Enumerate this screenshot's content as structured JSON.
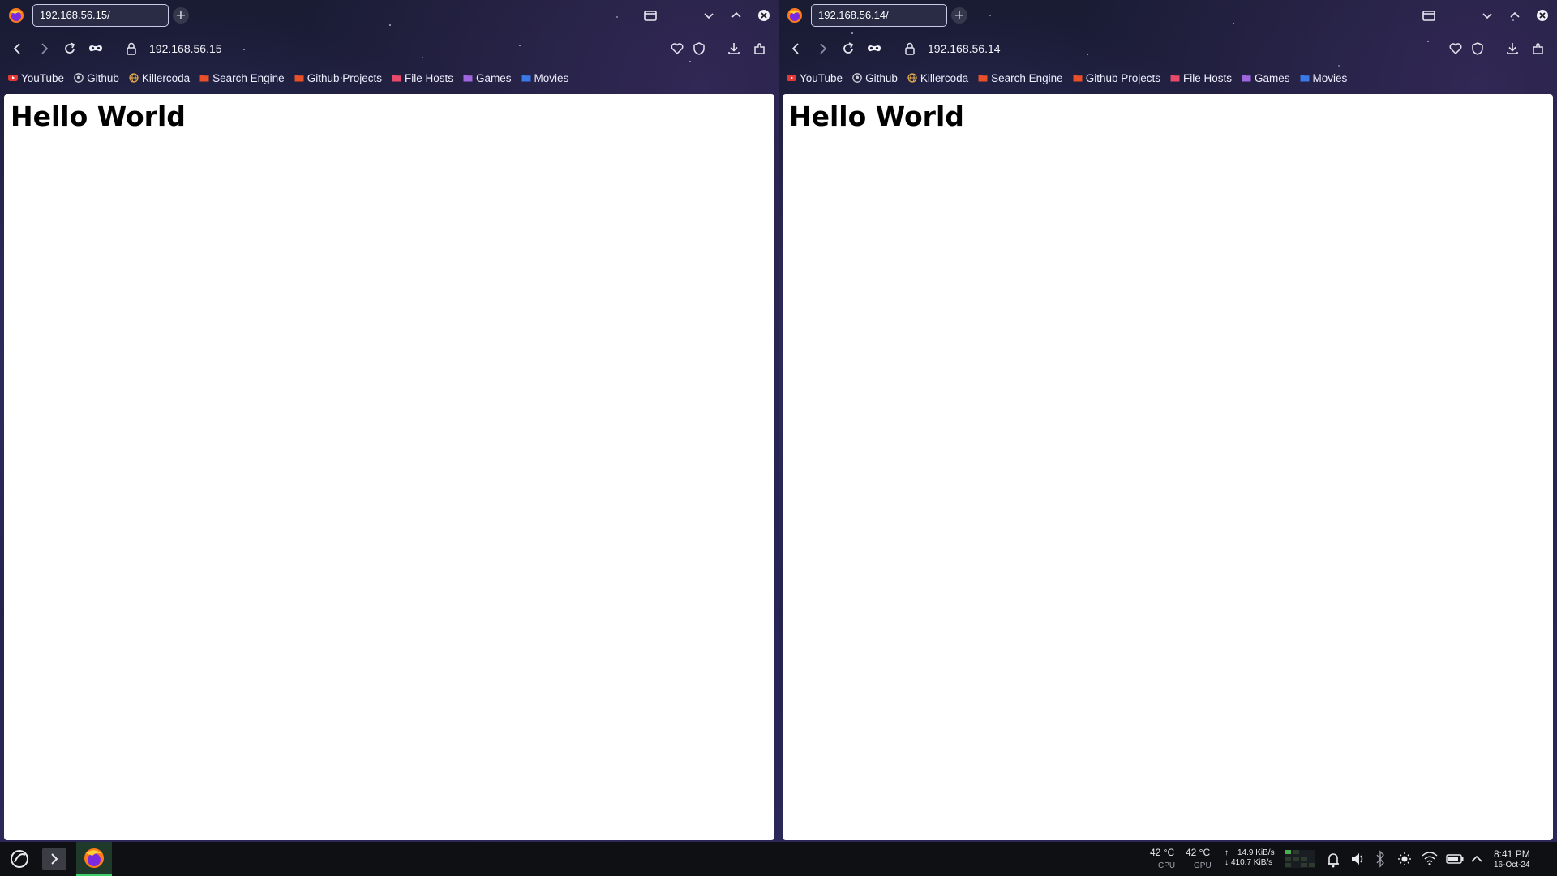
{
  "windows": [
    {
      "tab_title": "192.168.56.15/",
      "url": "192.168.56.15",
      "heading": "Hello World",
      "bookmarks": [
        {
          "label": "YouTube",
          "icon": "youtube-icon",
          "color": "#e53935"
        },
        {
          "label": "Github",
          "icon": "github-icon",
          "color": "#d0d0d8"
        },
        {
          "label": "Killercoda",
          "icon": "globe-icon",
          "color": "#e8b04a"
        },
        {
          "label": "Search Engine",
          "icon": "folder-icon",
          "color": "#e8502a"
        },
        {
          "label": "Github Projects",
          "icon": "folder-icon",
          "color": "#e8502a"
        },
        {
          "label": "File Hosts",
          "icon": "folder-icon",
          "color": "#e84a6a"
        },
        {
          "label": "Games",
          "icon": "folder-icon",
          "color": "#a066e0"
        },
        {
          "label": "Movies",
          "icon": "folder-icon",
          "color": "#3a7ae8"
        }
      ]
    },
    {
      "tab_title": "192.168.56.14/",
      "url": "192.168.56.14",
      "heading": "Hello World",
      "bookmarks": [
        {
          "label": "YouTube",
          "icon": "youtube-icon",
          "color": "#e53935"
        },
        {
          "label": "Github",
          "icon": "github-icon",
          "color": "#d0d0d8"
        },
        {
          "label": "Killercoda",
          "icon": "globe-icon",
          "color": "#e8b04a"
        },
        {
          "label": "Search Engine",
          "icon": "folder-icon",
          "color": "#e8502a"
        },
        {
          "label": "Github Projects",
          "icon": "folder-icon",
          "color": "#e8502a"
        },
        {
          "label": "File Hosts",
          "icon": "folder-icon",
          "color": "#e84a6a"
        },
        {
          "label": "Games",
          "icon": "folder-icon",
          "color": "#a066e0"
        },
        {
          "label": "Movies",
          "icon": "folder-icon",
          "color": "#3a7ae8"
        }
      ]
    }
  ],
  "taskbar": {
    "cpu_temp": "42 °C",
    "cpu_label": "CPU",
    "gpu_temp": "42 °C",
    "gpu_label": "GPU",
    "net_up": "14.9 KiB/s",
    "net_down": "410.7 KiB/s",
    "time": "8:41 PM",
    "date": "16-Oct-24"
  }
}
